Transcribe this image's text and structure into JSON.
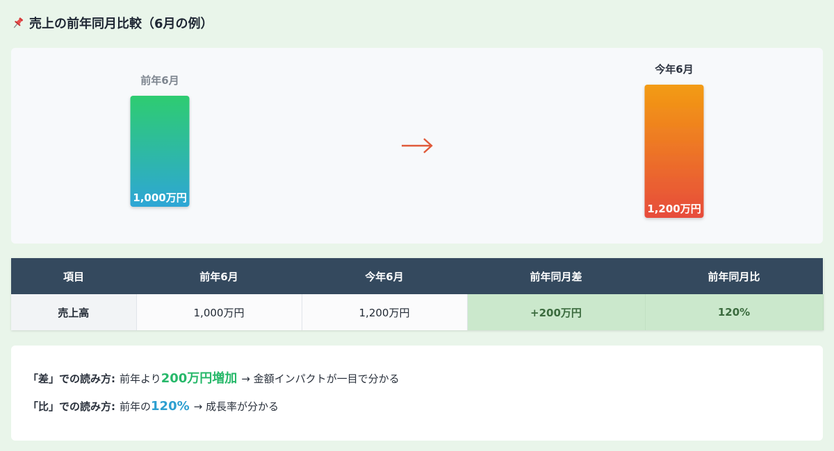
{
  "title": "売上の前年同月比較（6月の例）",
  "icons": {
    "title": "pushpin-icon",
    "arrow": "right-arrow-icon"
  },
  "colors": {
    "prev_bar_top": "#2ecc71",
    "prev_bar_bottom": "#2ea6d6",
    "curr_bar_top": "#f39c12",
    "curr_bar_bottom": "#e74c3c",
    "arrow": "#e05a3a",
    "table_header": "#34495e",
    "highlight": "#cbe8cc"
  },
  "chart_data": {
    "type": "bar",
    "categories": [
      "前年6月",
      "今年6月"
    ],
    "values": [
      1000,
      1200
    ],
    "value_labels": [
      "1,000万円",
      "1,200万円"
    ],
    "title": "",
    "xlabel": "",
    "ylabel": "",
    "ylim": [
      0,
      1200
    ]
  },
  "table": {
    "headers": [
      "項目",
      "前年6月",
      "今年6月",
      "前年同月差",
      "前年同月比"
    ],
    "rows": [
      [
        "売上高",
        "1,000万円",
        "1,200万円",
        "+200万円",
        "120%"
      ]
    ]
  },
  "notes": [
    {
      "label": "「差」での読み方:",
      "pre": "前年より",
      "em": "200万円増加",
      "post": "→ 金額インパクトが一目で分かる"
    },
    {
      "label": "「比」での読み方:",
      "pre": "前年の",
      "em": "120%",
      "post": "→ 成長率が分かる"
    }
  ]
}
